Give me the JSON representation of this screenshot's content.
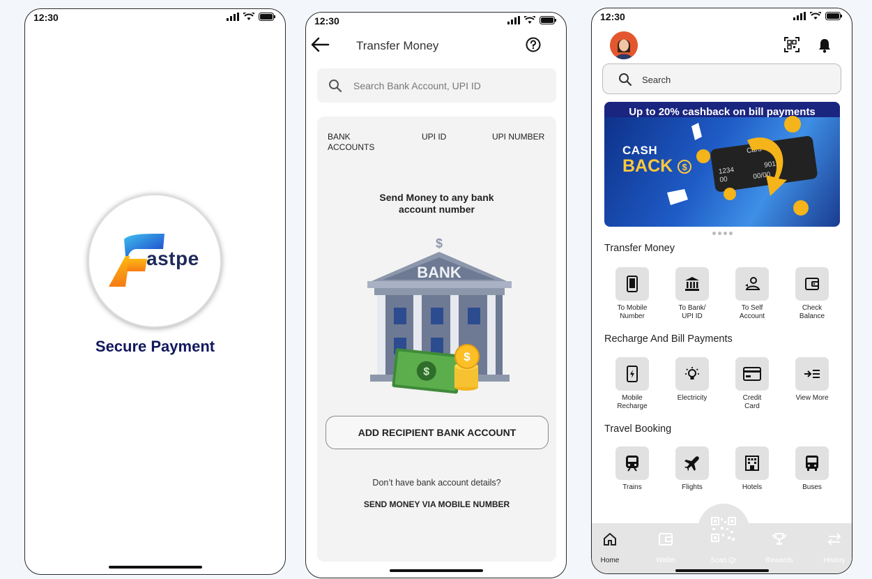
{
  "status": {
    "time": "12:30"
  },
  "splash": {
    "logo_text": "astpe",
    "title": "Secure Payment"
  },
  "transfer": {
    "title": "Transfer Money",
    "search_placeholder": "Search Bank Account, UPI ID",
    "tabs": [
      "BANK\nACCOUNTS",
      "UPI ID",
      "UPI NUMBER"
    ],
    "send_text_line1": "Send  Money to any bank",
    "send_text_line2": "account number",
    "bank_sign": "BANK",
    "add_button": "ADD RECIPIENT BANK ACCOUNT",
    "dont_have": "Don’t have bank account details?",
    "send_mobile": "SEND MONEY VIA MOBILE NUMBER"
  },
  "home": {
    "search_placeholder": "Search",
    "banner_headline": "Up to 20% cashback on bill payments",
    "banner_cash": "CASH",
    "banner_back": "BACK",
    "card_text": "Card",
    "card_number_1": "1234",
    "card_number_2": "9012",
    "card_expiry": "00/00",
    "card_00": "00",
    "sections": {
      "transfer": "Transfer Money",
      "recharge": "Recharge And Bill Payments",
      "travel": "Travel Booking"
    },
    "transfer_items": [
      "To Mobile\nNumber",
      "To  Bank/\nUPI ID",
      "To  Self\nAccount",
      "Check\nBalance"
    ],
    "recharge_items": [
      "Mobile\nRecharge",
      "Electricity",
      "Credit\nCard",
      "View More"
    ],
    "travel_items": [
      "Trains",
      "Flights",
      "Hotels",
      "Buses"
    ],
    "nav": [
      "Home",
      "Wallet",
      "Scan Qr",
      "Rewards",
      "History"
    ]
  },
  "colors": {
    "brand_navy": "#12185e",
    "logo_orange": "#f7941d",
    "logo_blue": "#1e5ed8",
    "banner_blue": "#1f5cc7",
    "banner_gold": "#ffc93c"
  }
}
